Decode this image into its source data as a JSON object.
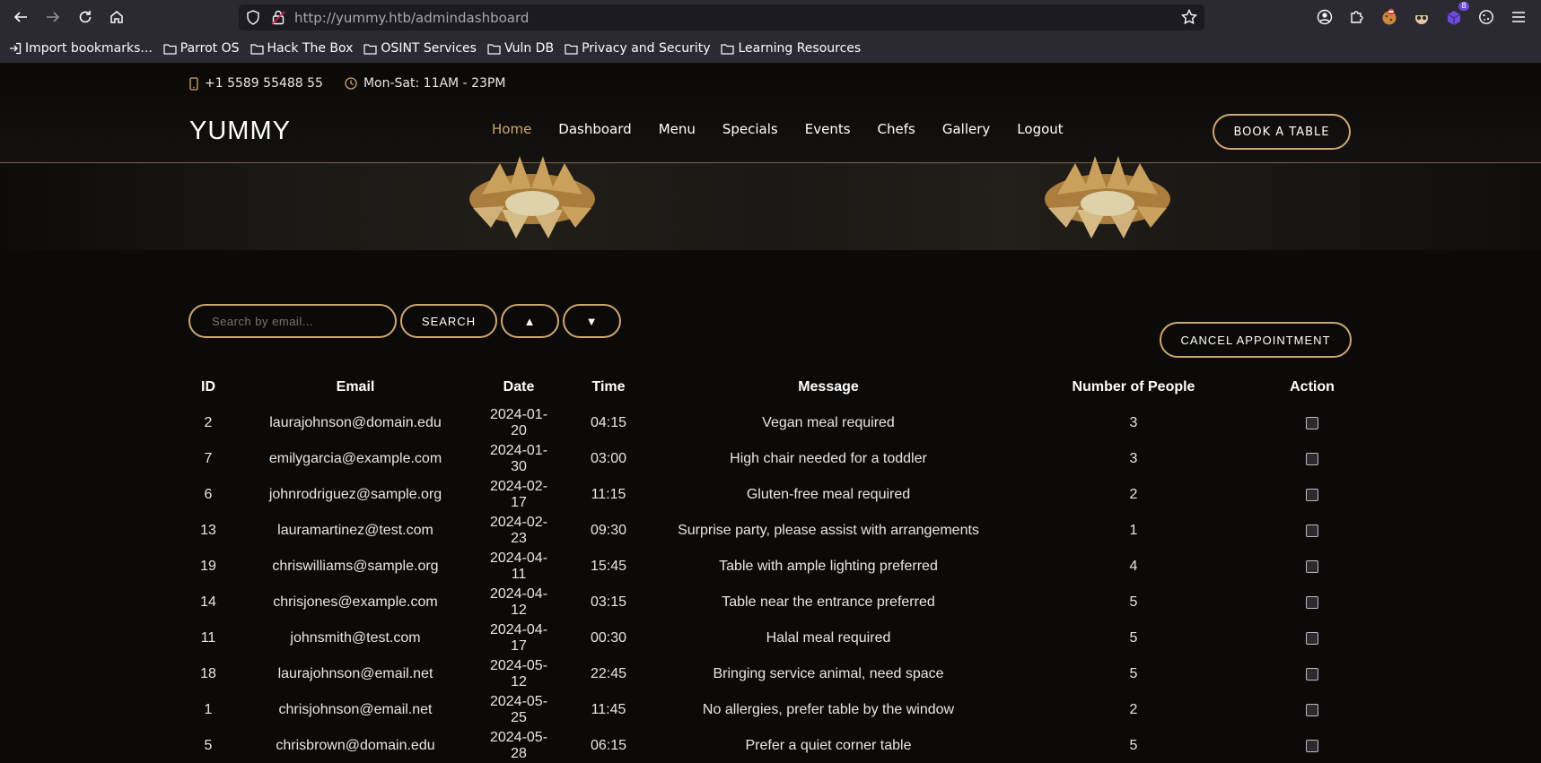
{
  "browser": {
    "url_host": "http://yummy.htb",
    "url_path": "/admindashboard",
    "bookmarks": [
      "Import bookmarks...",
      "Parrot OS",
      "Hack The Box",
      "OSINT Services",
      "Vuln DB",
      "Privacy and Security",
      "Learning Resources"
    ],
    "ext_badge": "8"
  },
  "topbar": {
    "phone": "+1 5589 55488 55",
    "hours": "Mon-Sat: 11AM - 23PM"
  },
  "header": {
    "logo": "YUMMY",
    "nav": [
      "Home",
      "Dashboard",
      "Menu",
      "Specials",
      "Events",
      "Chefs",
      "Gallery",
      "Logout"
    ],
    "book_label": "BOOK A TABLE"
  },
  "controls": {
    "search_placeholder": "Search by email...",
    "search_label": "SEARCH",
    "sort_up": "▲",
    "sort_down": "▼",
    "cancel_label": "CANCEL APPOINTMENT"
  },
  "table": {
    "headers": [
      "ID",
      "Email",
      "Date",
      "Time",
      "Message",
      "Number of People",
      "Action"
    ],
    "rows": [
      [
        "2",
        "laurajohnson@domain.edu",
        "2024-01-20",
        "04:15",
        "Vegan meal required",
        "3"
      ],
      [
        "7",
        "emilygarcia@example.com",
        "2024-01-30",
        "03:00",
        "High chair needed for a toddler",
        "3"
      ],
      [
        "6",
        "johnrodriguez@sample.org",
        "2024-02-17",
        "11:15",
        "Gluten-free meal required",
        "2"
      ],
      [
        "13",
        "lauramartinez@test.com",
        "2024-02-23",
        "09:30",
        "Surprise party, please assist with arrangements",
        "1"
      ],
      [
        "19",
        "chriswilliams@sample.org",
        "2024-04-11",
        "15:45",
        "Table with ample lighting preferred",
        "4"
      ],
      [
        "14",
        "chrisjones@example.com",
        "2024-04-12",
        "03:15",
        "Table near the entrance preferred",
        "5"
      ],
      [
        "11",
        "johnsmith@test.com",
        "2024-04-17",
        "00:30",
        "Halal meal required",
        "5"
      ],
      [
        "18",
        "laurajohnson@email.net",
        "2024-05-12",
        "22:45",
        "Bringing service animal, need space",
        "5"
      ],
      [
        "1",
        "chrisjohnson@email.net",
        "2024-05-25",
        "11:45",
        "No allergies, prefer table by the window",
        "2"
      ],
      [
        "5",
        "chrisbrown@domain.edu",
        "2024-05-28",
        "06:15",
        "Prefer a quiet corner table",
        "5"
      ]
    ]
  }
}
